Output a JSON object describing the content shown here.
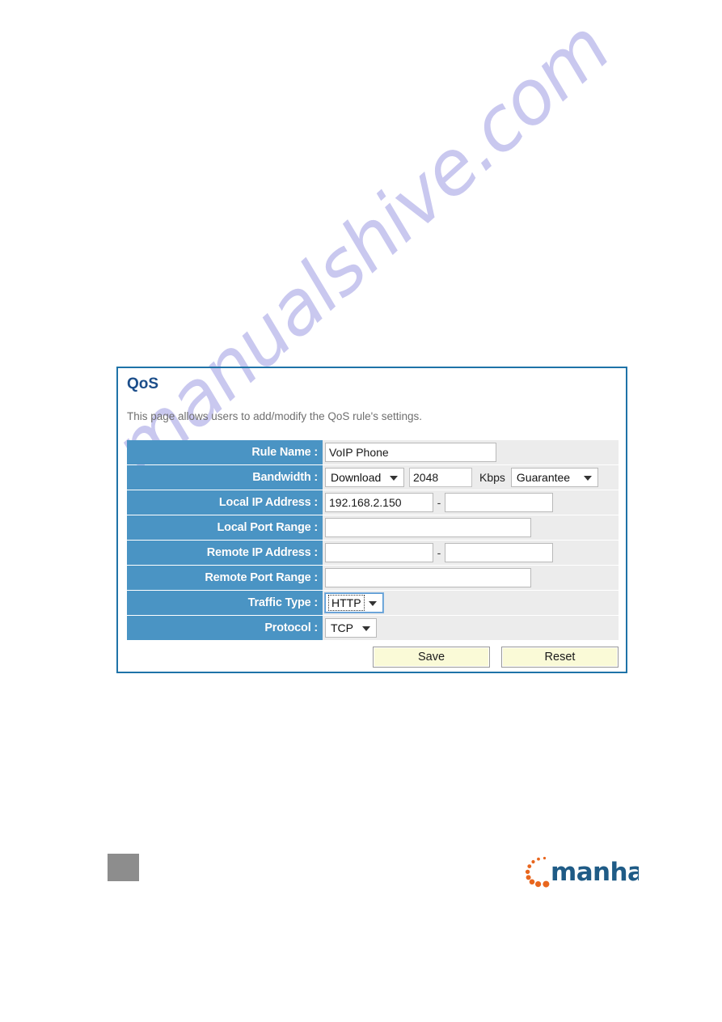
{
  "watermark": {
    "text": "manualshive.com"
  },
  "panel": {
    "title": "QoS",
    "description": "This page allows users to add/modify the QoS rule's settings."
  },
  "form": {
    "rows": [
      {
        "label": "Rule Name :",
        "value": "VoIP Phone",
        "placeholder": ""
      },
      {
        "label": "Bandwidth :",
        "direction": "Download",
        "rate": "2048",
        "unit": "Kbps",
        "mode": "Guarantee"
      },
      {
        "label": "Local IP Address :",
        "start": "192.168.2.150",
        "separator": "-",
        "end": "",
        "placeholder": ""
      },
      {
        "label": "Local Port Range :",
        "value": "",
        "placeholder": ""
      },
      {
        "label": "Remote IP Address :",
        "start": "",
        "separator": "-",
        "end": "",
        "placeholder": ""
      },
      {
        "label": "Remote Port Range :",
        "value": "",
        "placeholder": ""
      },
      {
        "label": "Traffic Type :",
        "value": "HTTP"
      },
      {
        "label": "Protocol :",
        "value": "TCP"
      }
    ]
  },
  "buttons": {
    "save_label": "Save",
    "reset_label": "Reset"
  },
  "brand": {
    "name": "manhattan",
    "text_color": "#1f5b86",
    "dot_color": "#e8661e"
  },
  "colors": {
    "panel_border": "#1f73a8",
    "label_blue": "#4a94c4",
    "row_background": "#ececec",
    "title_blue": "#1c4e8a",
    "button_yellow": "#fafad7",
    "watermark": "#c9c8ef"
  }
}
